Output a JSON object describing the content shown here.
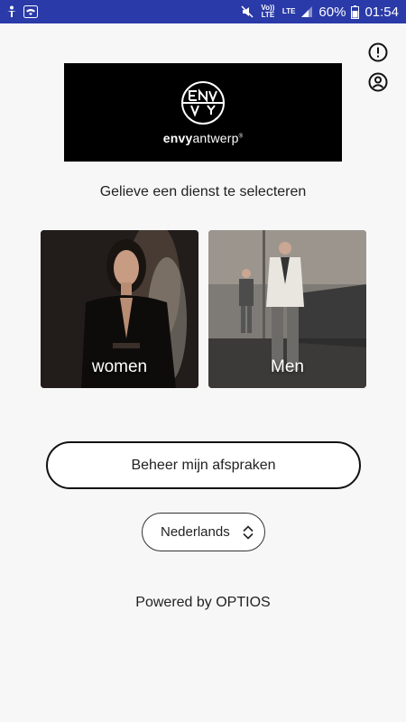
{
  "status_bar": {
    "lte_label_1": "Vo)) LTE",
    "lte_label_2": "LTE",
    "battery": "60%",
    "time": "01:54"
  },
  "header": {
    "alert_icon": "alert-circle-icon",
    "account_icon": "account-circle-icon"
  },
  "logo": {
    "brand_bold": "envy",
    "brand_light": "antwerp",
    "mark": "®"
  },
  "prompt": "Gelieve een dienst te selecteren",
  "services": [
    {
      "label": "women"
    },
    {
      "label": "Men"
    }
  ],
  "manage_button": "Beheer mijn afspraken",
  "language": {
    "selected": "Nederlands",
    "icon": "updown-chevron-icon"
  },
  "footer": "Powered by OPTIOS",
  "colors": {
    "status_bar": "#2a3aa8",
    "background": "#f7f7f7",
    "logo_bg": "#000000"
  }
}
